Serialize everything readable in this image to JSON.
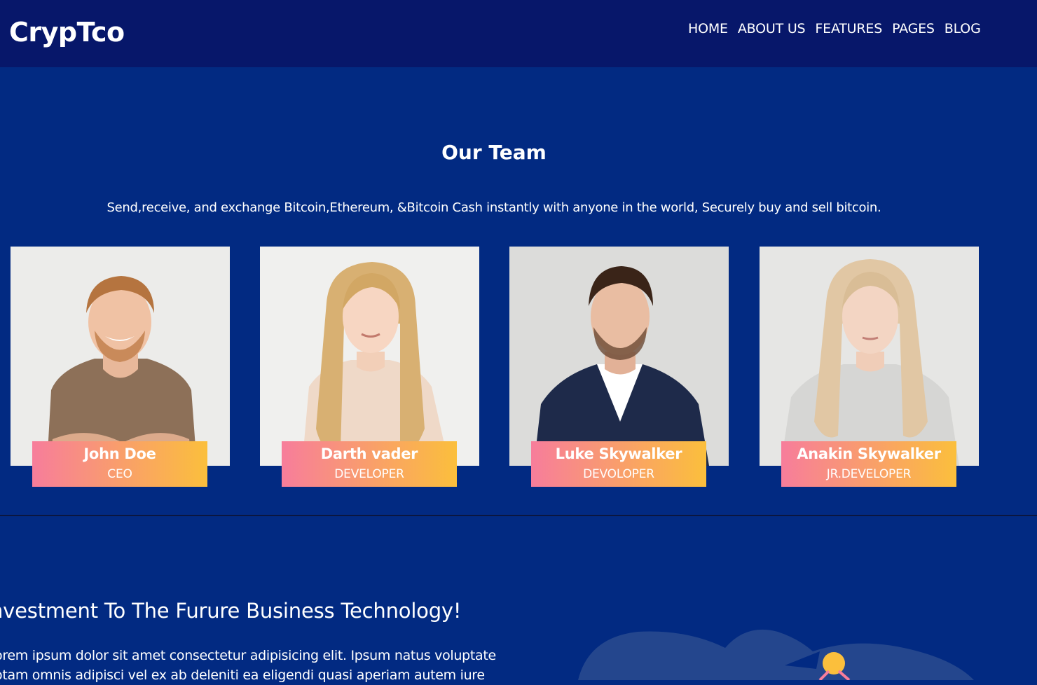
{
  "header": {
    "logo": "CrypTco",
    "nav": [
      "HOME",
      "ABOUT US",
      "FEATURES",
      "PAGES",
      "BLOG"
    ]
  },
  "team": {
    "title": "Our Team",
    "subtitle": "Send,receive, and exchange Bitcoin,Ethereum, &Bitcoin Cash instantly with anyone in the world, Securely buy and sell bitcoin.",
    "members": [
      {
        "name": "John Doe",
        "role": "CEO"
      },
      {
        "name": "Darth vader",
        "role": "DEVELOPER"
      },
      {
        "name": "Luke Skywalker",
        "role": "DEVOLOPER"
      },
      {
        "name": "Anakin Skywalker",
        "role": "JR.DEVELOPER"
      }
    ]
  },
  "investment": {
    "title": "nvestment To The Furure Business Technology!",
    "body_lines": [
      "orem ipsum dolor sit amet consectetur adipisicing elit. Ipsum natus voluptate",
      "otam omnis adipisci vel ex ab deleniti ea eligendi quasi aperiam autem iure"
    ]
  },
  "colors": {
    "header_bg": "#07176a",
    "page_bg": "#022a82",
    "tag_gradient_start": "#f77d9b",
    "tag_gradient_end": "#fbbf3c"
  }
}
